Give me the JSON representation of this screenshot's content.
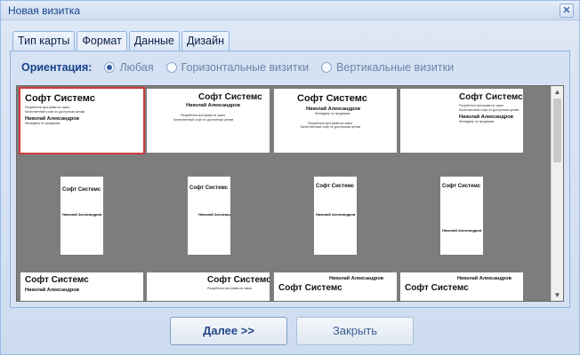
{
  "window": {
    "title": "Новая визитка",
    "close_symbol": "✕"
  },
  "tabs": [
    {
      "label": "Тип карты",
      "active": false
    },
    {
      "label": "Формат",
      "active": true
    },
    {
      "label": "Данные",
      "active": false
    },
    {
      "label": "Дизайн",
      "active": false
    }
  ],
  "orientation": {
    "label": "Ориентация:",
    "options": [
      {
        "label": "Любая",
        "selected": true
      },
      {
        "label": "Горизонтальные визитки",
        "selected": false
      },
      {
        "label": "Вертикальные визитки",
        "selected": false
      }
    ]
  },
  "card_text": {
    "company": "Софт Системс",
    "person": "Николай Александров",
    "position": "Менеджер по продажам",
    "service_1": "Разработка программ на заказ",
    "service_2": "Качественный софт по доступным ценам"
  },
  "buttons": {
    "next": "Далее >>",
    "close": "Закрыть"
  },
  "colors": {
    "selection": "#d23b3b",
    "gallery_bg": "#7d7d7d",
    "accent": "#15428b"
  }
}
